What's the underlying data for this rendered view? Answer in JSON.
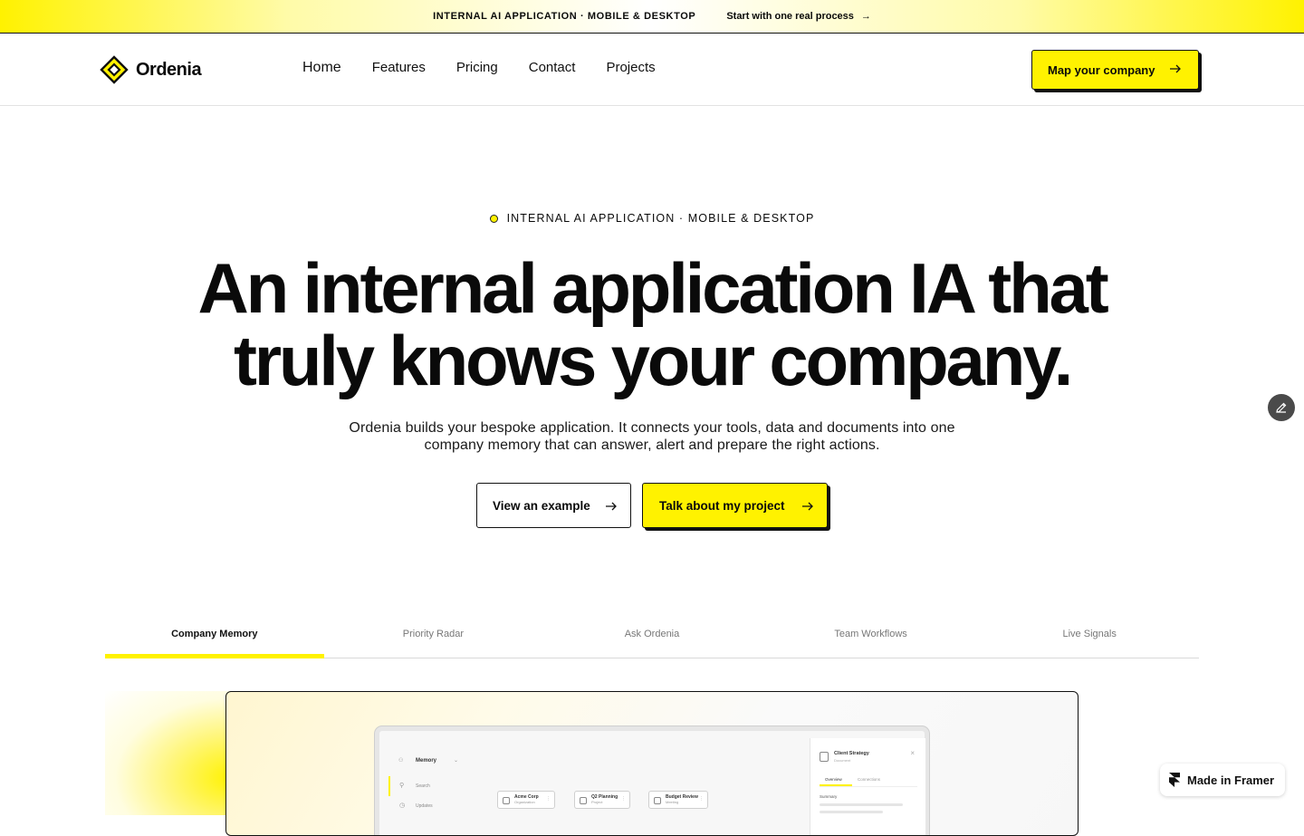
{
  "announcement": {
    "tag": "INTERNAL AI APPLICATION · MOBILE & DESKTOP",
    "link_label": "Start with one real process",
    "link_arrow": "→"
  },
  "brand": {
    "name": "Ordenia",
    "accent": "#fff200",
    "ink": "#0a0a0a"
  },
  "nav": {
    "links": [
      "Home",
      "Features",
      "Pricing",
      "Contact",
      "Projects"
    ],
    "cta_label": "Map your company"
  },
  "hero": {
    "eyebrow": "INTERNAL AI APPLICATION · MOBILE & DESKTOP",
    "headline_line1": "An internal application IA that",
    "headline_line2": "truly knows your company.",
    "subtitle_line1": "Ordenia builds your bespoke application. It connects your tools, data and documents into one",
    "subtitle_line2": "company memory that can answer, alert and prepare the right actions.",
    "secondary_cta": "View an example",
    "primary_cta": "Talk about my project"
  },
  "tabs": {
    "items": [
      "Company Memory",
      "Priority Radar",
      "Ask Ordenia",
      "Team Workflows",
      "Live Signals"
    ],
    "active_index": 0
  },
  "preview": {
    "sidebar_title": "Memory",
    "search_label": "Search",
    "updates_label": "Updates",
    "nodes": [
      {
        "title": "Acme Corp",
        "sub": "Organization"
      },
      {
        "title": "Q2 Planning",
        "sub": "Project"
      },
      {
        "title": "Budget Review",
        "sub": "Meeting"
      }
    ],
    "panel": {
      "title": "Client Strategy",
      "sub": "Document",
      "tab_overview": "Overview",
      "tab_connections": "Connections",
      "summary_label": "Summary"
    }
  },
  "badge": {
    "label": "Made in Framer"
  },
  "icons": {
    "logo": "diamond-logo-icon",
    "arrow": "arrow-right-icon",
    "edit": "pencil-icon",
    "framer": "framer-logo-icon"
  }
}
